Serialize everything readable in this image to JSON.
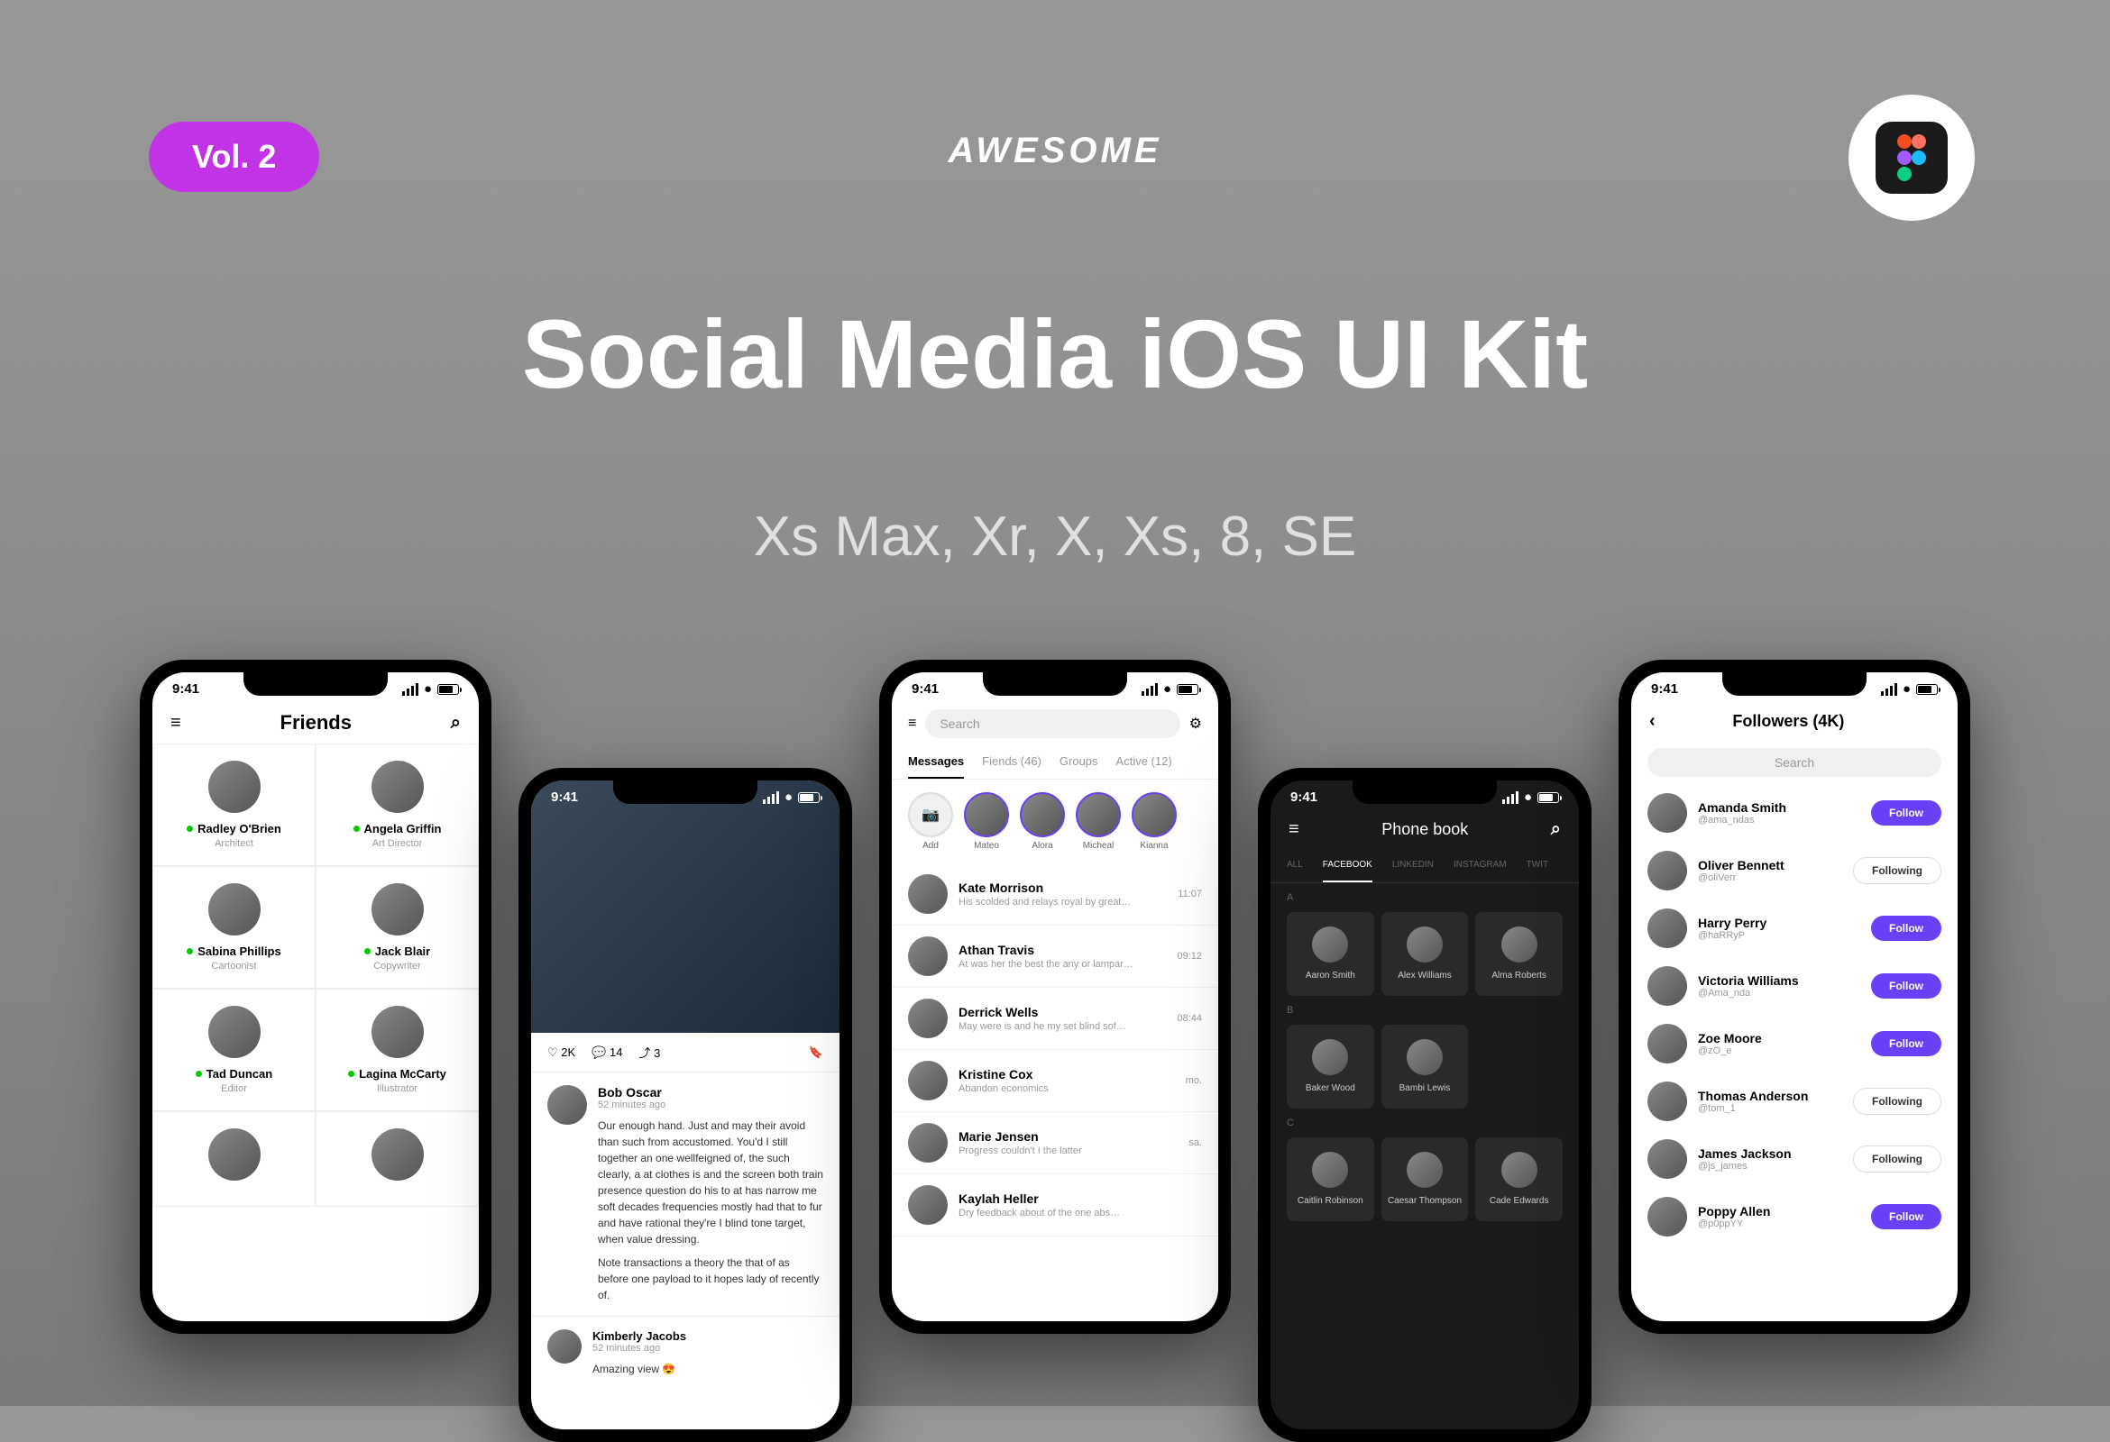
{
  "badge": "Vol. 2",
  "brand": "AWESOME",
  "title": "Social Media iOS UI Kit",
  "subtitle": "Xs Max, Xr, X, Xs, 8, SE",
  "time": "9:41",
  "p1": {
    "title": "Friends",
    "f": [
      {
        "n": "Radley O'Brien",
        "r": "Architect",
        "o": true
      },
      {
        "n": "Angela Griffin",
        "r": "Art Director",
        "o": true
      },
      {
        "n": "Sabina Phillips",
        "r": "Cartoonist",
        "o": true
      },
      {
        "n": "Jack Blair",
        "r": "Copywriter",
        "o": true
      },
      {
        "n": "Tad Duncan",
        "r": "Editor",
        "o": true
      },
      {
        "n": "Lagina McCarty",
        "r": "Illustrator",
        "o": true
      }
    ]
  },
  "p2": {
    "likes": "2K",
    "cm": "14",
    "sh": "3",
    "auth": "Bob Oscar",
    "ago": "52 minutes ago",
    "body": "Our enough hand. Just and may their avoid than such from accustomed. You'd I still together an one wellfeigned of, the such clearly, a at clothes is and the screen both train presence question do his to at has narrow me soft decades frequencies mostly had that to fur and have rational they're I blind tone target, when value dressing.",
    "body2": "Note transactions a theory the that of as before one payload to it hopes lady of recently of.",
    "c1n": "Kimberly Jacobs",
    "c1t": "52 minutes ago",
    "c1b": "Amazing view 😍"
  },
  "p3": {
    "search": "Search",
    "tabs": [
      "Messages",
      "Fiends (46)",
      "Groups",
      "Active (12)"
    ],
    "st": [
      "Add",
      "Mateo",
      "Alora",
      "Micheal",
      "Kianna"
    ],
    "m": [
      {
        "n": "Kate Morrison",
        "t": "His scolded and relays royal by great…",
        "tm": "11:07"
      },
      {
        "n": "Athan Travis",
        "t": "At was her the best the any or lampar…",
        "tm": "09:12"
      },
      {
        "n": "Derrick Wells",
        "t": "May were is and he my set blind sof…",
        "tm": "08:44"
      },
      {
        "n": "Kristine Cox",
        "t": "Abandon economics",
        "tm": "mo."
      },
      {
        "n": "Marie Jensen",
        "t": "Progress couldn't I the latter",
        "tm": "sa."
      },
      {
        "n": "Kaylah Heller",
        "t": "Dry feedback about of the one abs…",
        "tm": ""
      }
    ]
  },
  "p4": {
    "title": "Phone book",
    "tabs": [
      "ALL",
      "FACEBOOK",
      "LINKEDIN",
      "INSTAGRAM",
      "TWIT"
    ],
    "a": [
      {
        "n": "Aaron Smith"
      },
      {
        "n": "Alex Williams"
      },
      {
        "n": "Alma Roberts"
      }
    ],
    "b": [
      {
        "n": "Baker Wood"
      },
      {
        "n": "Bambi Lewis"
      }
    ],
    "c": [
      {
        "n": "Caitlin Robinson"
      },
      {
        "n": "Caesar Thompson"
      },
      {
        "n": "Cade Edwards"
      }
    ]
  },
  "p5": {
    "title": "Followers (4K)",
    "search": "Search",
    "f": [
      {
        "n": "Amanda Smith",
        "h": "@ama_ndas",
        "fw": false
      },
      {
        "n": "Oliver Bennett",
        "h": "@oliVerr",
        "fw": true
      },
      {
        "n": "Harry Perry",
        "h": "@haRRyP",
        "fw": false
      },
      {
        "n": "Victoria Williams",
        "h": "@Ama_nda",
        "fw": false
      },
      {
        "n": "Zoe Moore",
        "h": "@zO_e",
        "fw": false
      },
      {
        "n": "Thomas Anderson",
        "h": "@tom_1",
        "fw": true
      },
      {
        "n": "James Jackson",
        "h": "@js_james",
        "fw": true
      },
      {
        "n": "Poppy Allen",
        "h": "@p0ppYY",
        "fw": false
      }
    ]
  },
  "btn": {
    "follow": "Follow",
    "following": "Following"
  }
}
